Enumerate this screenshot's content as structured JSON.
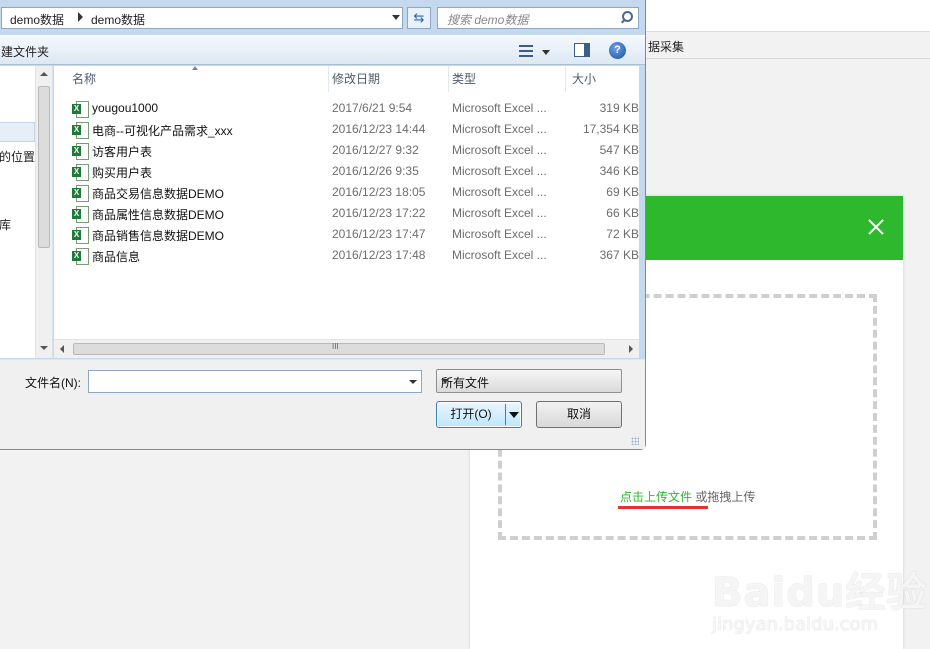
{
  "background_page": {
    "menu_partial_label": "据采集",
    "upload_modal": {
      "drop_zone": {
        "upload_link": "点击上传文件",
        "hint_text": " 或拖拽上传"
      }
    },
    "watermark": {
      "main": "Baidu经验",
      "sub": "jingyan.baidu.com"
    }
  },
  "dialog": {
    "address": {
      "crumbs": [
        "demo数据",
        "demo数据"
      ]
    },
    "search": {
      "placeholder": "搜索 demo数据"
    },
    "toolbar": {
      "new_folder_partial": "建文件夹"
    },
    "nav_pane": {
      "items": [
        "的位置",
        "库"
      ]
    },
    "columns": [
      "名称",
      "修改日期",
      "类型",
      "大小"
    ],
    "files": [
      {
        "name": "yougou1000",
        "date": "2017/6/21 9:54",
        "type": "Microsoft Excel ...",
        "size": "319 KB"
      },
      {
        "name": "电商--可视化产品需求_xxx",
        "date": "2016/12/23 14:44",
        "type": "Microsoft Excel ...",
        "size": "17,354 KB"
      },
      {
        "name": "访客用户表",
        "date": "2016/12/27 9:32",
        "type": "Microsoft Excel ...",
        "size": "547 KB"
      },
      {
        "name": "购买用户表",
        "date": "2016/12/26 9:35",
        "type": "Microsoft Excel ...",
        "size": "346 KB"
      },
      {
        "name": "商品交易信息数据DEMO",
        "date": "2016/12/23 18:05",
        "type": "Microsoft Excel ...",
        "size": "69 KB"
      },
      {
        "name": "商品属性信息数据DEMO",
        "date": "2016/12/23 17:22",
        "type": "Microsoft Excel ...",
        "size": "66 KB"
      },
      {
        "name": "商品销售信息数据DEMO",
        "date": "2016/12/23 17:47",
        "type": "Microsoft Excel ...",
        "size": "72 KB"
      },
      {
        "name": "商品信息",
        "date": "2016/12/23 17:48",
        "type": "Microsoft Excel ...",
        "size": "367 KB"
      }
    ],
    "scroll_grip_label": "III",
    "filename": {
      "label": "文件名(N):",
      "value": ""
    },
    "filetype": {
      "selected": "所有文件"
    },
    "buttons": {
      "open": "打开(O)",
      "cancel": "取消"
    },
    "icons": {
      "file_icon": "excel-file-icon",
      "help": "help-icon",
      "refresh": "refresh-icon",
      "search": "search-icon"
    }
  },
  "colors": {
    "modal_header": "#2eb82e",
    "upload_link": "#2eb82e",
    "highlight_underline": "#e83030",
    "dialog_frame": "#c5d9ee"
  }
}
